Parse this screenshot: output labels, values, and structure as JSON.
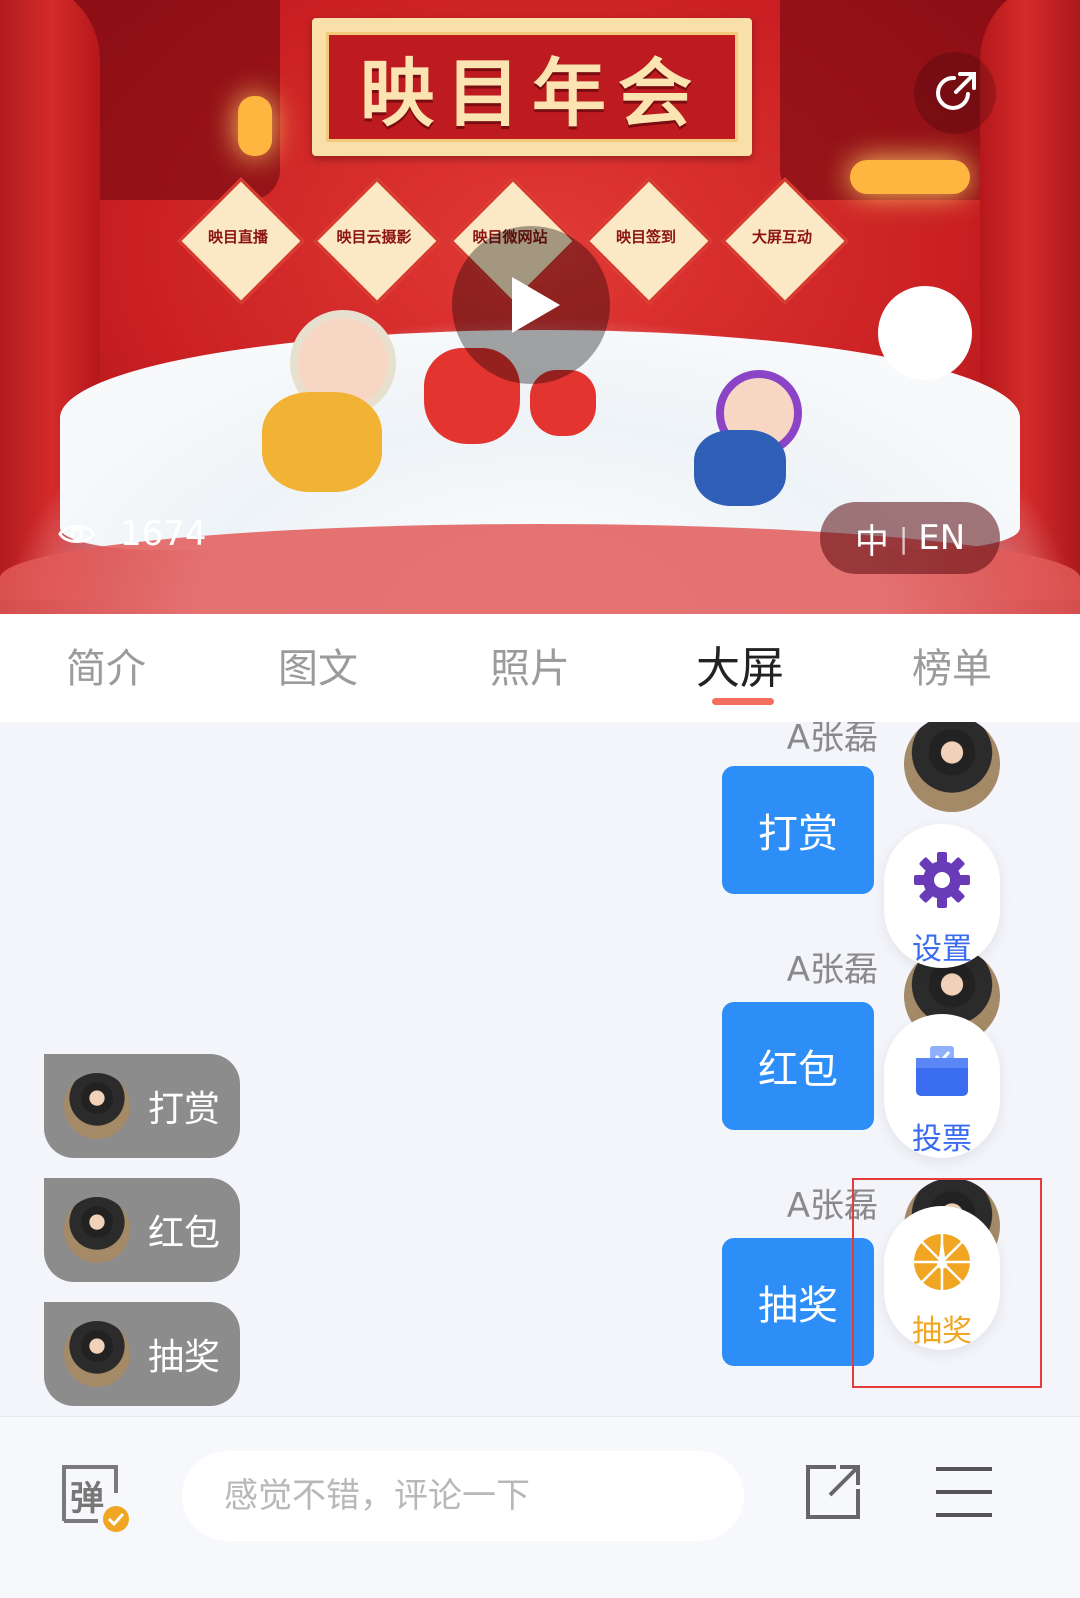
{
  "banner": {
    "title": "映目年会",
    "diamonds": [
      "映目直播",
      "映目云摄影",
      "映目微网站",
      "映目签到",
      "大屏互动"
    ],
    "view_count": "1674",
    "lang_zh": "中",
    "lang_sep": "|",
    "lang_en": "EN",
    "icons": [
      "eye-icon",
      "play-icon",
      "share-icon"
    ]
  },
  "tabs": [
    {
      "label": "简介"
    },
    {
      "label": "图文"
    },
    {
      "label": "照片"
    },
    {
      "label": "大屏",
      "active": true
    },
    {
      "label": "榜单"
    }
  ],
  "chat": {
    "messages": [
      {
        "name": "A张磊",
        "text": "打赏"
      },
      {
        "name": "A张磊",
        "text": "红包"
      },
      {
        "name": "A张磊",
        "text": "抽奖"
      }
    ]
  },
  "side_actions": [
    {
      "label": "设置",
      "icon": "gear-icon",
      "color": "#6a3bb8"
    },
    {
      "label": "投票",
      "icon": "vote-box-icon",
      "color": "#3a6cf0"
    },
    {
      "label": "抽奖",
      "icon": "lottery-wheel-icon",
      "color": "#f0a623"
    }
  ],
  "floating_pills": [
    {
      "text": "打赏"
    },
    {
      "text": "红包"
    },
    {
      "text": "抽奖"
    }
  ],
  "bottom_bar": {
    "danmu_glyph": "弹",
    "comment_placeholder": "感觉不错，评论一下"
  },
  "colors": {
    "accent_blue": "#2c8ef6",
    "tab_underline": "#f46e5d",
    "highlight_box": "#e63b3b",
    "lottery_orange": "#f0a623"
  }
}
